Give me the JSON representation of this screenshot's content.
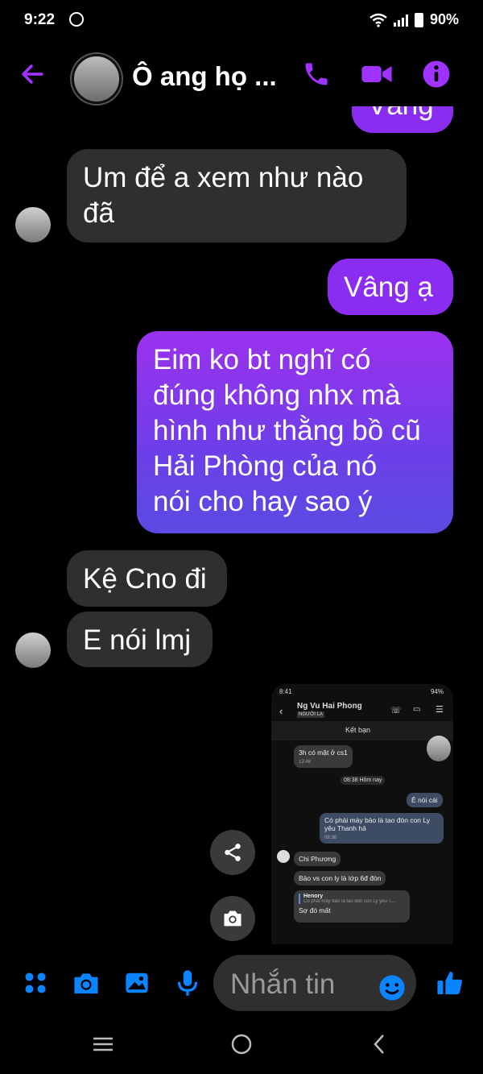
{
  "status_bar": {
    "time": "9:22",
    "battery": "90%"
  },
  "header": {
    "title": "Ô ang họ ..."
  },
  "messages": {
    "partial_top": "Vâng",
    "m1": [
      "Um để a xem như nào",
      "đã"
    ],
    "m2": "Vâng ạ",
    "m3": [
      "Eim ko bt nghĩ có",
      "đúng không nhx mà",
      "hình như thằng bồ cũ",
      "Hải Phòng của nó",
      "nói cho hay sao ý"
    ],
    "m4": "Kệ Cno đi",
    "m5": "E nói lmj"
  },
  "shared_screenshot": {
    "time": "8:41",
    "battery": "94%",
    "contact_name": "Ng Vu Hai Phong",
    "contact_badge": "NGƯỜI LẠ",
    "add_friend": "Kết bạn",
    "msg1": "3h có mặt ở cs1",
    "msg1_time": "13:48",
    "date_sep": "08:38 Hôm nay",
    "msg2": "Ê nói cái",
    "msg3": [
      "Có phải mày bảo là tao đòn con Ly",
      "yêu Thanh hả"
    ],
    "msg3_time": "08:38",
    "sender": "Chi Phương",
    "msg4": "Bảo vs con ly là lớp 6đ đòn",
    "reply_name": "Henory",
    "reply_quote": "Có phải mày bảo là tao đòn con Ly yêu T...",
    "msg5": "Sợ đó mất"
  },
  "composer": {
    "placeholder": "Nhắn tin"
  },
  "colors": {
    "accent": "#a033ff",
    "outgoing": "#8b2df0",
    "composer_icons": "#0a84ff"
  }
}
